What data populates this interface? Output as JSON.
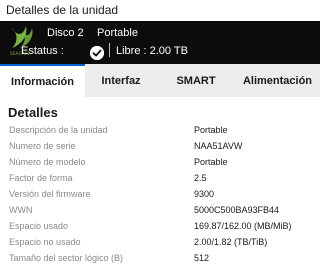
{
  "window": {
    "title": "Detalles de la unidad"
  },
  "header": {
    "disk_label": "Disco 2",
    "disk_type": "Portable",
    "status_label": "Estatus :",
    "free_label": "Libre : 2.00 TB",
    "status_icon": "check-circle-icon",
    "brand": "SEAGATE"
  },
  "tabs": [
    {
      "label": "Información",
      "active": true
    },
    {
      "label": "Interfaz",
      "active": false
    },
    {
      "label": "SMART",
      "active": false
    },
    {
      "label": "Alimentación",
      "active": false
    }
  ],
  "details": {
    "title": "Detalles",
    "rows": [
      {
        "label": "Descripción de la unidad",
        "value": "Portable"
      },
      {
        "label": "Numero de serie",
        "value": "NAA51AVW"
      },
      {
        "label": "Número de modelo",
        "value": "Portable"
      },
      {
        "label": "Factor de forma",
        "value": "2.5"
      },
      {
        "label": "Versión del firmware",
        "value": "9300"
      },
      {
        "label": "WWN",
        "value": "5000C500BA93FB44"
      },
      {
        "label": "Espacio usado",
        "value": "169.87/162.00 (MB/MiB)"
      },
      {
        "label": "Espacio no usado",
        "value": "2.00/1.82 (TB/TiB)"
      },
      {
        "label": "Tamaño del sector lógico (B)",
        "value": "512"
      }
    ]
  },
  "colors": {
    "accent": "#0066cc",
    "header_bg": "#0c0c0c",
    "brand_green": "#79b342"
  }
}
